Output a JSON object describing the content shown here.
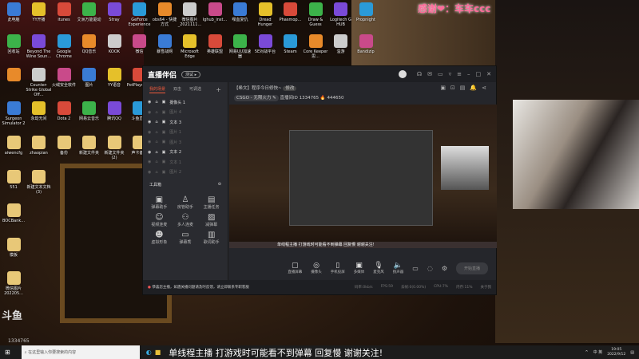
{
  "desktop": {
    "rows": [
      [
        "此电脑",
        "YY开播",
        "itunes",
        "艾洲万能驱动",
        "Stray",
        "GeForce Experience",
        "obs64 - 快捷方式",
        "微信图片_2021111...",
        "lghub_inst...",
        "喋血复仇",
        "Dread Hunger",
        "Phasmop...",
        "Draw & Guess",
        "Logitech G HUB",
        "Propnight"
      ],
      [
        "回收站",
        "Beyond The Wine Soun...",
        "Google Chrome",
        "QQ音乐",
        "KOOK",
        "微信",
        "暴雪战网",
        "Microsoft Edge",
        "英雄联盟",
        "网易UU加速器",
        "5E对战平台",
        "Steam",
        "Core Keeper 思...",
        "溢游",
        "Bandizip"
      ],
      [
        "",
        "Counter-Strike Global Off...",
        "火绒安全软件",
        "图片",
        "YY语音",
        "PotPlayer bit"
      ],
      [
        "Surgeon Simulator 2",
        "永劫无间",
        "Dota 2",
        "网易云音乐",
        "腾讯QQ",
        "斗鱼直播"
      ],
      [
        "aiwencfg",
        "zhaopian",
        "备份",
        "新建文件夹",
        "新建文件夹(2)",
        "声卡备份"
      ],
      [
        "551",
        "新建文本文档(3)"
      ],
      [
        "BOCBank..."
      ],
      [
        "模板"
      ],
      [
        "微信图片 202205..."
      ]
    ],
    "colors": [
      "#3a7bd5",
      "#e5c02a",
      "#d84a3a",
      "#3cb34a",
      "#7a4ad8",
      "#2a9ad8",
      "#e88a2a",
      "#ccc",
      "#c94a8a"
    ]
  },
  "overlay": {
    "thanks": "感谢❤：车车ccc",
    "platform": "斗鱼",
    "room_id": "1334765"
  },
  "app": {
    "title": "直播伴侣",
    "badge": "测试 ▸",
    "tabs": [
      "我的场景",
      "双击",
      "可调选"
    ],
    "add": "+",
    "layers": [
      {
        "n": "摄像头 1",
        "v": true
      },
      {
        "n": "图片 4",
        "v": false
      },
      {
        "n": "文本 3",
        "v": true
      },
      {
        "n": "图片 1",
        "v": false
      },
      {
        "n": "图片 3",
        "v": false
      },
      {
        "n": "文本 2",
        "v": true
      },
      {
        "n": "文本 1",
        "v": false
      },
      {
        "n": "图片 2",
        "v": false
      }
    ],
    "toolbox_title": "工具箱",
    "tools": [
      "弹幕助手",
      "房管助手",
      "主播任务",
      "视频连麦",
      "多人连麦",
      "减弹幕",
      "虚拟形象",
      "弹幕秀",
      "歌词助手"
    ],
    "stream_title": "【希文】程序今日修快~",
    "edit_tag": "修改",
    "category": "CSGO - 无限火力 ✎",
    "room_label": "直播间ID",
    "room_id": "1334765",
    "hot": "🔥 444650",
    "ticker": "单线程主播 打游戏时可能看不到弹幕 回复慢 谢谢关注!",
    "controls": [
      "直播屏幕",
      "摄像头",
      "手机投屏",
      "多媒体",
      "麦克风",
      "扬声器"
    ],
    "start": "开始直播",
    "notice": "恭喜您主播，如遇关播问题请及时反馈，请立即联系专职客服",
    "stats": [
      "码率:0kb/s",
      "FPS:59",
      "丢帧:0(0.00%)",
      "CPU:7%",
      "内存:11%",
      "关于我"
    ]
  },
  "taskbar": {
    "search": "在这里输入你要搜索的内容",
    "marquee": "单线程主播 打游戏时可能看不到弹幕 回复慢 谢谢关注!",
    "ime": "中 英",
    "time": "19:05",
    "date": "2022/9/12"
  }
}
